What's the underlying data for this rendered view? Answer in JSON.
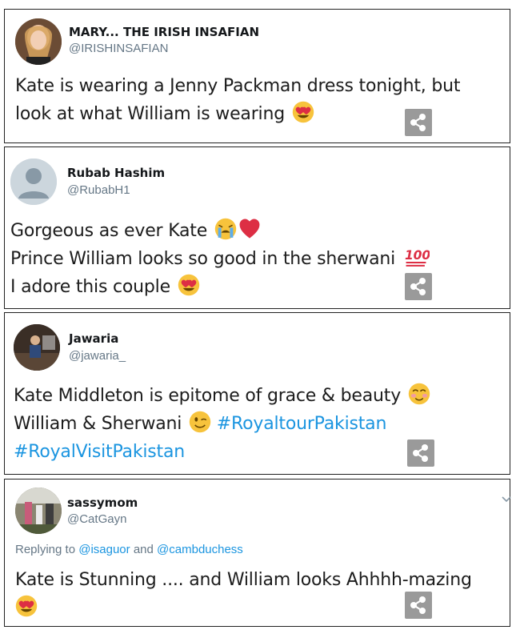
{
  "tweets": [
    {
      "name": "MARY... THE IRISH INSAFIAN",
      "handle": "@IRISHINSAFIAN",
      "lines": [
        "Kate is wearing a Jenny Packman dress tonight, but",
        "look at what William is wearing"
      ],
      "emoji": "heart-eyes"
    },
    {
      "name": "Rubab Hashim",
      "handle": "@RubabH1",
      "lines": [
        "Gorgeous as ever Kate",
        "Prince William looks so good in the sherwani",
        "I adore this couple"
      ],
      "emoji": [
        "crying-face",
        "red-heart",
        "hundred-points",
        "heart-eyes"
      ]
    },
    {
      "name": "Jawaria",
      "handle": "@jawaria_",
      "lines": [
        "Kate Middleton is epitome of grace & beauty",
        "William & Sherwani"
      ],
      "hashtags": [
        "#RoyaltourPakistan",
        "#RoyalVisitPakistan"
      ],
      "emoji": [
        "smiling-blush",
        "winking-face"
      ]
    },
    {
      "name": "sassymom",
      "handle": "@CatGayn",
      "reply_prefix": "Replying to",
      "reply_mentions": [
        "@isaguor",
        "@cambduchess"
      ],
      "reply_and": "and",
      "lines": [
        "Kate is Stunning .... and William looks Ahhhh-mazing"
      ],
      "emoji": "heart-eyes"
    }
  ]
}
